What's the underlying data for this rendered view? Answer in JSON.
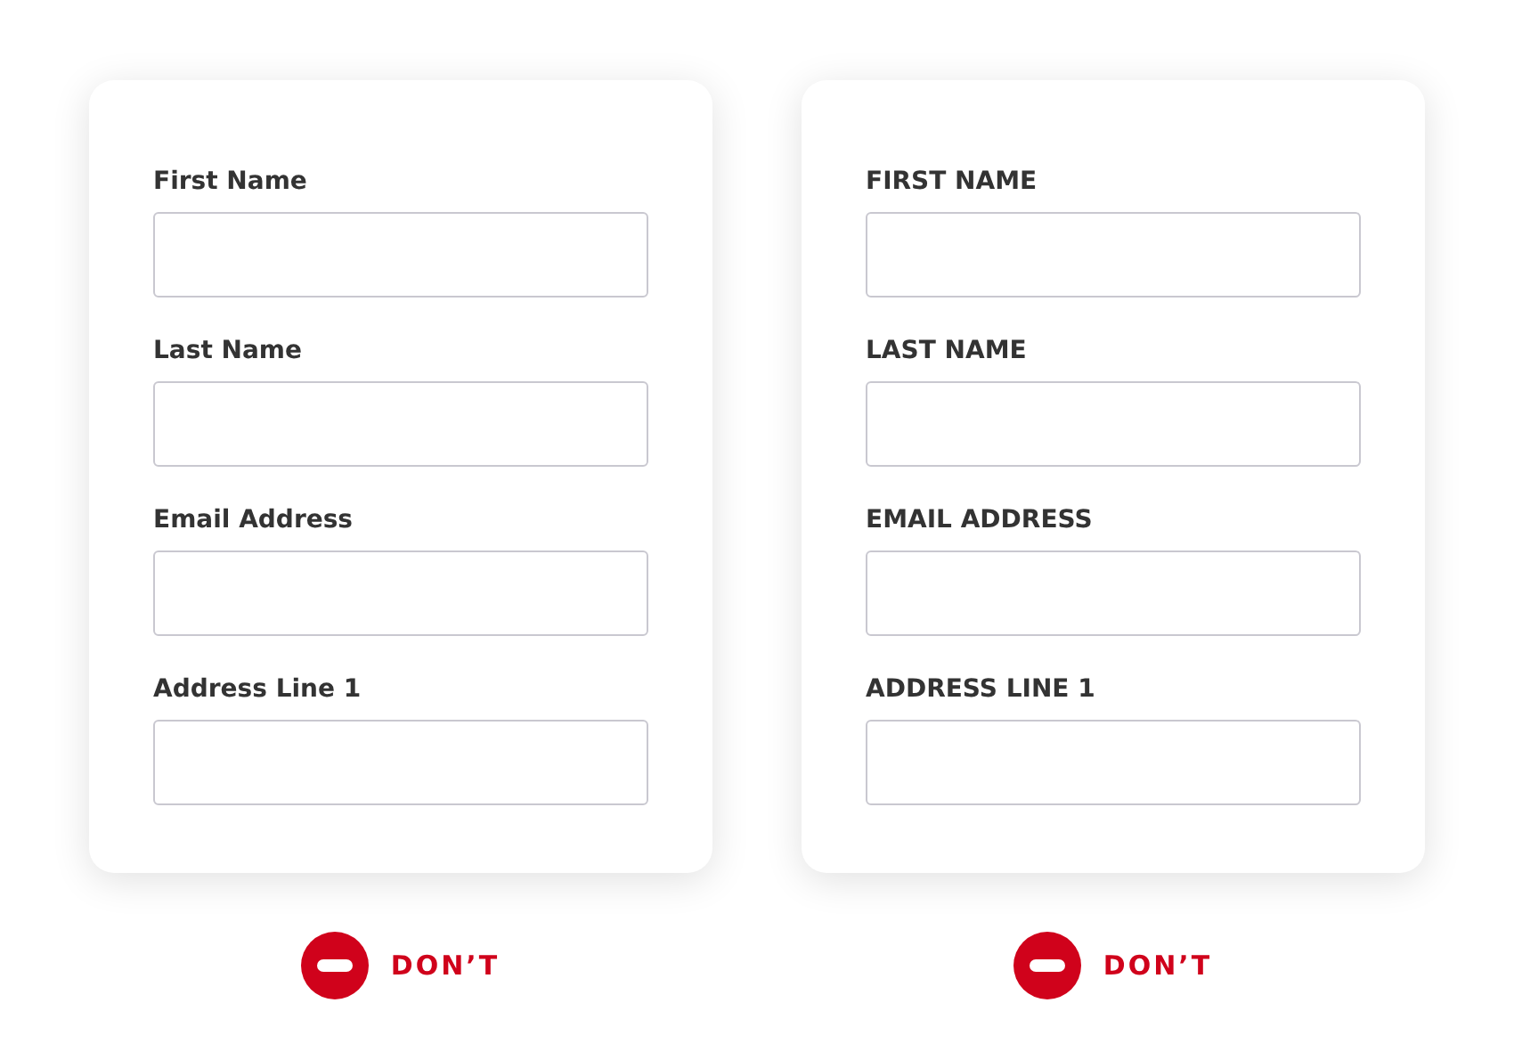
{
  "panels": [
    {
      "fields": [
        {
          "label": "First Name"
        },
        {
          "label": "Last Name"
        },
        {
          "label": "Email Address"
        },
        {
          "label": "Address Line 1"
        }
      ],
      "verdict": {
        "kind": "dont",
        "text": "DON’T"
      }
    },
    {
      "fields": [
        {
          "label": "FIRST NAME"
        },
        {
          "label": "LAST NAME"
        },
        {
          "label": "EMAIL ADDRESS"
        },
        {
          "label": "ADDRESS LINE 1"
        }
      ],
      "verdict": {
        "kind": "dont",
        "text": "DON’T"
      }
    }
  ]
}
